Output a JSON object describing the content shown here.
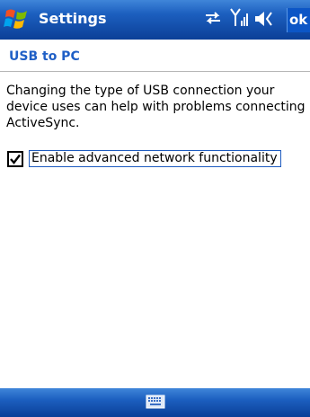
{
  "titlebar": {
    "title": "Settings",
    "ok_label": "ok",
    "icons": [
      "windows-start-icon",
      "connectivity-icon",
      "signal-strength-icon",
      "speaker-icon"
    ]
  },
  "subheader": {
    "title": "USB to PC"
  },
  "main": {
    "description": "Changing the type of USB connection your device uses can help with problems connecting ActiveSync.",
    "checkbox": {
      "label": "Enable advanced network functionality",
      "checked": true
    }
  },
  "bottombar": {
    "icon": "keyboard-icon"
  },
  "colors": {
    "titlebar": "#1c5fbf",
    "accent_text": "#1f5fc6",
    "ok_button": "#0c56c6"
  }
}
